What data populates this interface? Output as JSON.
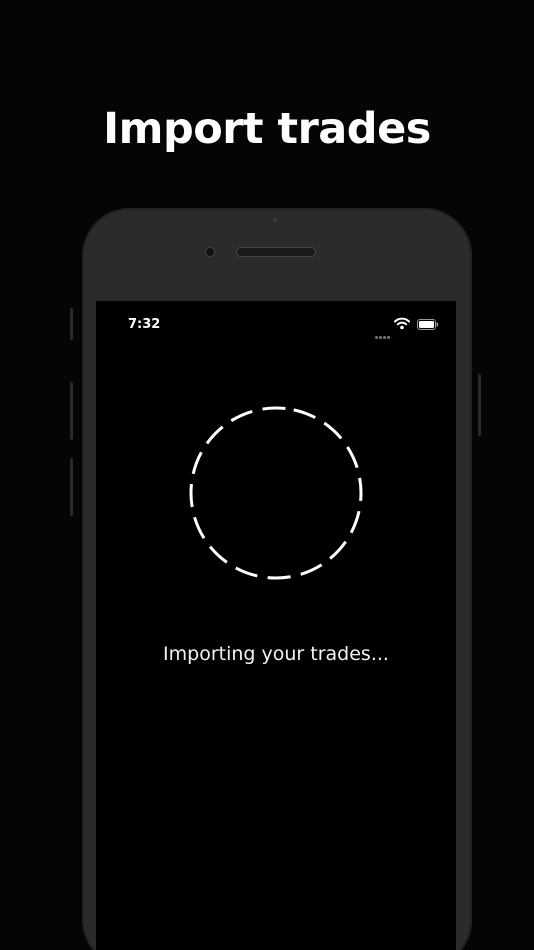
{
  "headline": "Import trades",
  "status_bar": {
    "time": "7:32",
    "icons": [
      "signal-dots-icon",
      "wifi-icon",
      "battery-icon"
    ]
  },
  "loading": {
    "spinner_icon": "dashed-circle-spinner-icon",
    "message": "Importing your trades..."
  },
  "colors": {
    "background": "#050505",
    "phone_frame": "#2b2b2b",
    "screen": "#000000",
    "text": "#ffffff"
  }
}
